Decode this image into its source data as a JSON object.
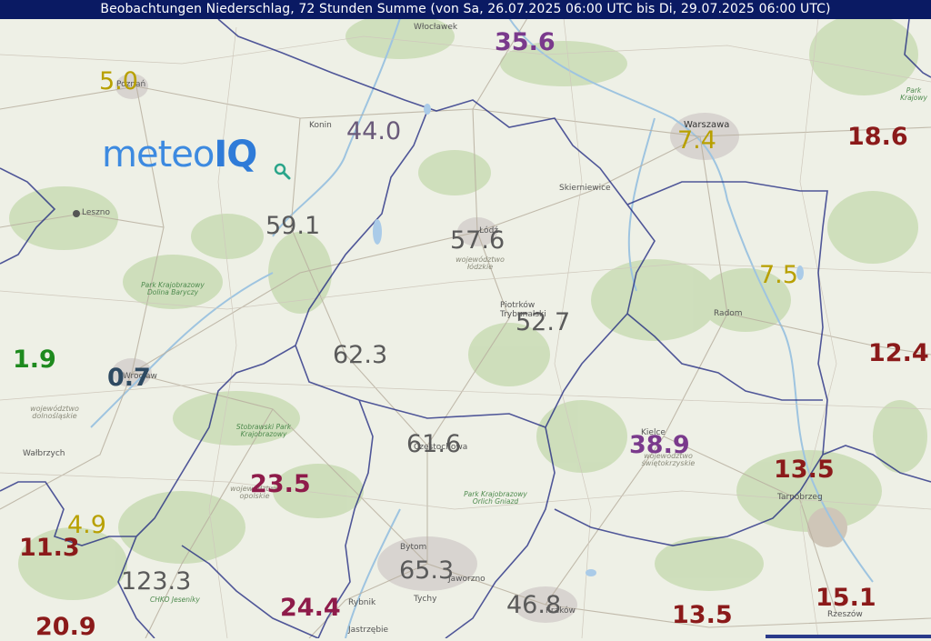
{
  "title": "Beobachtungen Niederschlag, 72 Stunden Summe (von Sa, 26.07.2025 06:00 UTC bis Di, 29.07.2025 06:00 UTC)",
  "logo": {
    "part1": "meteo",
    "part2": "IQ",
    "icon": "magnifier-icon"
  },
  "colors": {
    "title_bg": "#0a1a63",
    "yellow": "#b8a000",
    "dark_red": "#8b1a1a",
    "crimson": "#8e1b4a",
    "purple": "#7a3a8c",
    "gray": "#5a5a5a",
    "green": "#1e8a1e",
    "slate": "#2e4a62",
    "border": "#1a237e"
  },
  "values": [
    {
      "text": "35.6",
      "color": "#7a3a8c"
    },
    {
      "text": "5.0",
      "color": "#b8a000"
    },
    {
      "text": "44.0",
      "color": "#6a5a7a"
    },
    {
      "text": "7.4",
      "color": "#b8a000"
    },
    {
      "text": "18.6",
      "color": "#8b1a1a"
    },
    {
      "text": "59.1",
      "color": "#5a5a5a"
    },
    {
      "text": "57.6",
      "color": "#5a5a5a"
    },
    {
      "text": "7.5",
      "color": "#b8a000"
    },
    {
      "text": "52.7",
      "color": "#5a5a5a"
    },
    {
      "text": "62.3",
      "color": "#5a5a5a"
    },
    {
      "text": "12.4",
      "color": "#8b1a1a"
    },
    {
      "text": "1.9",
      "color": "#1e8a1e"
    },
    {
      "text": "0.7",
      "color": "#2e4a62"
    },
    {
      "text": "61.6",
      "color": "#5a5a5a"
    },
    {
      "text": "38.9",
      "color": "#7a3a8c"
    },
    {
      "text": "13.5",
      "color": "#8b1a1a"
    },
    {
      "text": "23.5",
      "color": "#8e1b4a"
    },
    {
      "text": "4.9",
      "color": "#b8a000"
    },
    {
      "text": "11.3",
      "color": "#8b1a1a"
    },
    {
      "text": "123.3",
      "color": "#5a5a5a"
    },
    {
      "text": "65.3",
      "color": "#5a5a5a"
    },
    {
      "text": "46.8",
      "color": "#5a5a5a"
    },
    {
      "text": "15.1",
      "color": "#8b1a1a"
    },
    {
      "text": "13.5",
      "color": "#8b1a1a"
    },
    {
      "text": "24.4",
      "color": "#8e1b4a"
    },
    {
      "text": "20.9",
      "color": "#8b1a1a"
    }
  ],
  "places": {
    "wloclawek": "Włocławek",
    "poznan": "Poznań",
    "konin": "Konin",
    "warszawa": "Warszawa",
    "skierniewice": "Skierniewice",
    "lodz": "Łódź",
    "radom": "Radom",
    "piotrkow": "Piotrków Trybunalski",
    "leszno": "Leszno",
    "wroclaw": "Wrocław",
    "walbrzych": "Wałbrzych",
    "kielce": "Kielce",
    "tarnobrzeg": "Tarnobrzeg",
    "czestochowa": "Częstochowa",
    "bytom": "Bytom",
    "tychy": "Tychy",
    "rybnik": "Rybnik",
    "jastrzebie": "Jastrzębie",
    "rzeszow": "Rzeszów",
    "krakow": "Kraków",
    "jaworzno": "Jaworzno"
  },
  "regions": {
    "lodzkie": "województwo łódzkie",
    "dolnoslaskie": "województwo dolnośląskie",
    "opolskie": "województwo opolskie",
    "swietokrzyskie": "województwo świętokrzyskie"
  },
  "parks": {
    "barycz": "Park Krajobrazowy Dolina Baryczy",
    "stobrawski": "Stobrawski Park Krajobrazowy",
    "orlich": "Park Krajobrazowy Orlich Gniazd",
    "jeseniky": "CHKO Jeseníky",
    "krajowy": "Park Krajowy"
  }
}
